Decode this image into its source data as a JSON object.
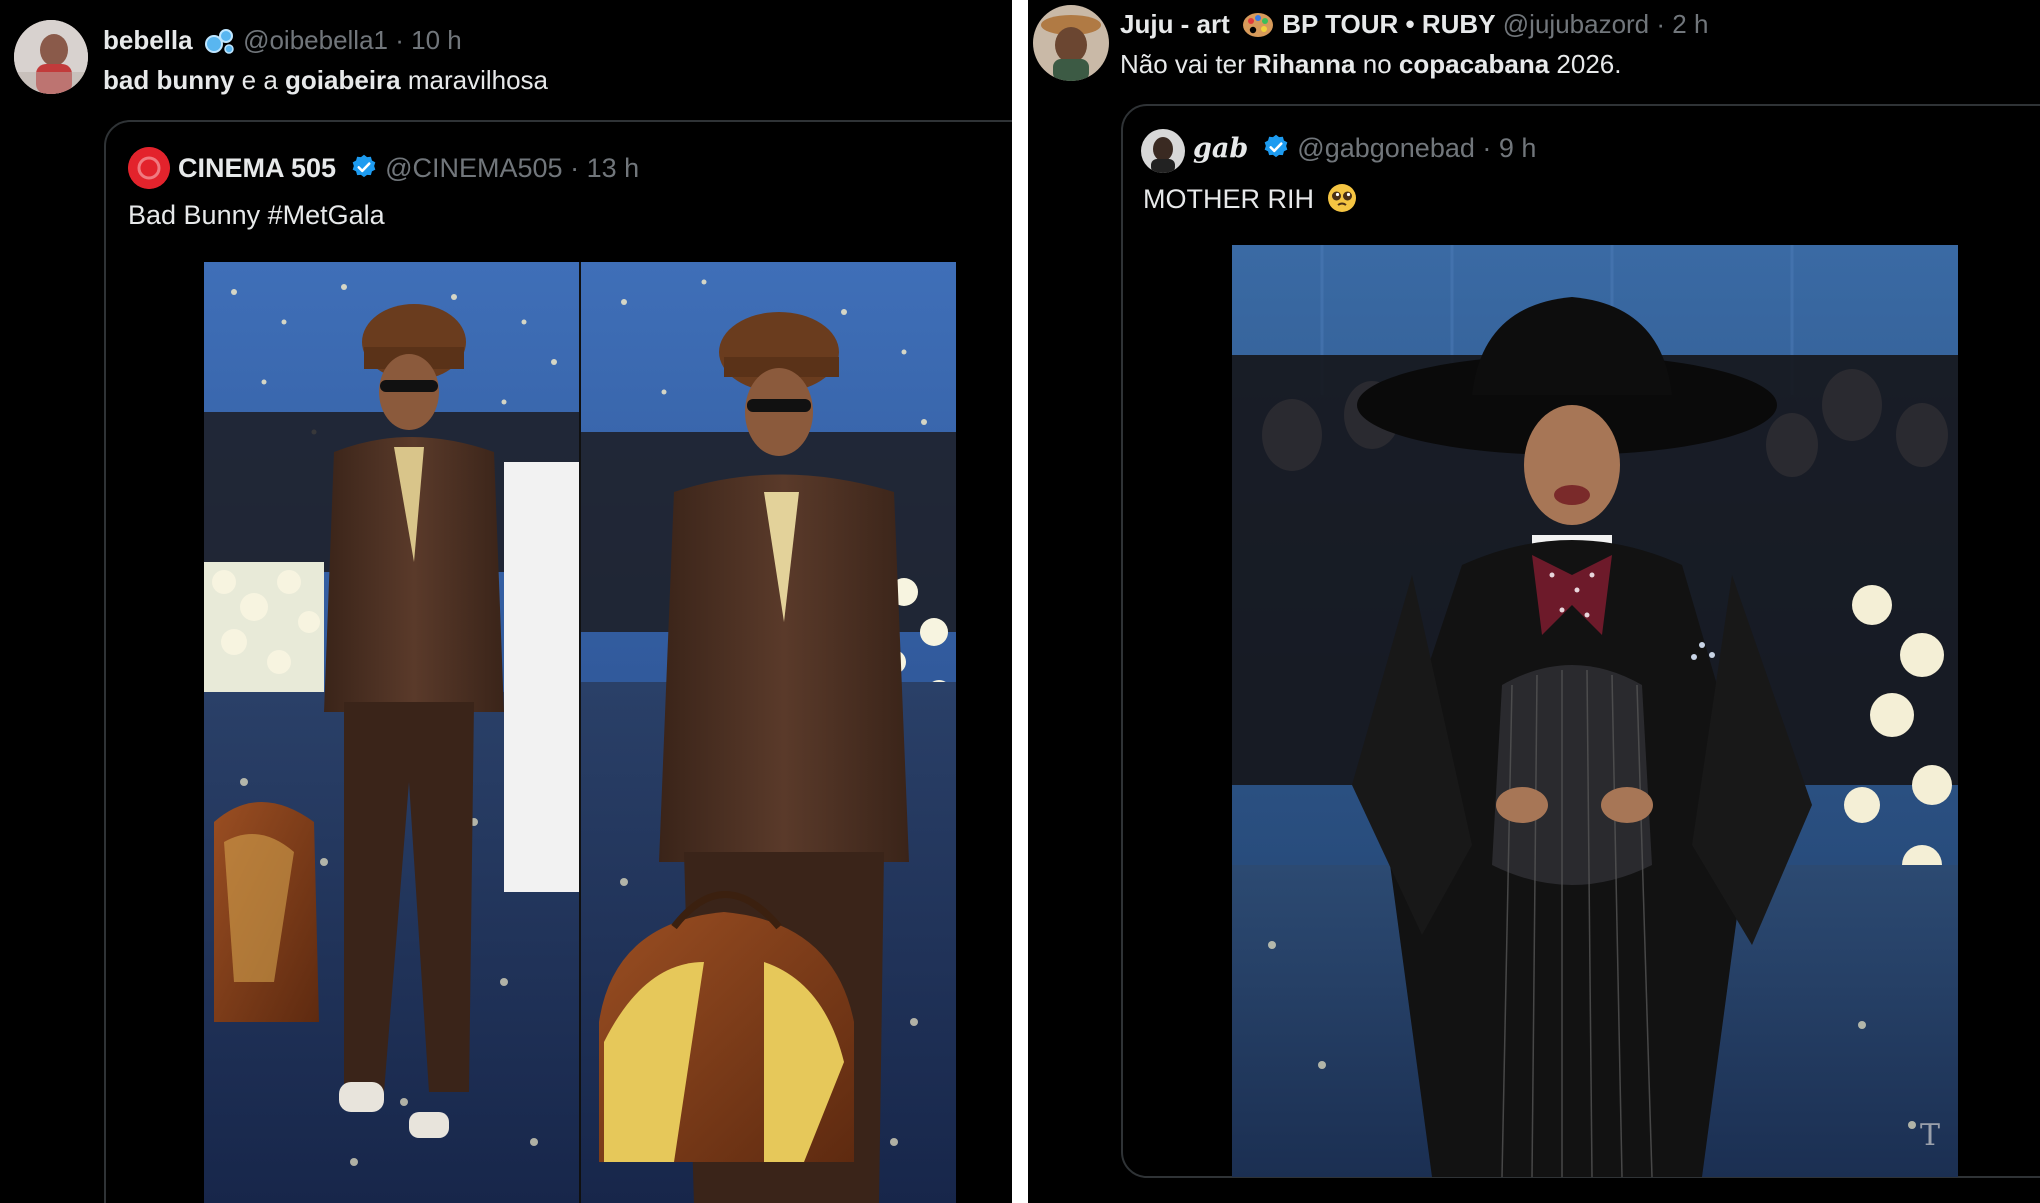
{
  "tweet_left": {
    "author_name": "bebella",
    "author_handle": "@oibebella1",
    "separator": "·",
    "time": "10 h",
    "text_parts": {
      "p1": "bad bunny",
      "p2": " e a ",
      "p3": "goiabeira",
      "p4": " maravilhosa"
    },
    "quoted": {
      "author_name": "CINEMA 505",
      "author_handle": "@CINEMA505",
      "separator": "·",
      "time": "13 h",
      "text": "Bad Bunny #MetGala",
      "media_icon": "photo-collage-bad-bunny-met-gala"
    }
  },
  "tweet_right": {
    "author_name": "Juju - art",
    "name_suffix": "BP TOUR • RUBY",
    "author_handle": "@jujubazord",
    "separator": "·",
    "time": "2 h",
    "text_parts": {
      "p1": "Não vai ter ",
      "p2": "Rihanna",
      "p3": " no ",
      "p4": "copacabana",
      "p5": " 2026."
    },
    "quoted": {
      "author_name": "gab",
      "author_handle": "@gabgonebad",
      "separator": "·",
      "time": "9 h",
      "text": "MOTHER RIH",
      "media_icon": "photo-rihanna-met-gala"
    }
  },
  "colors": {
    "background": "#000000",
    "text": "#e7e9ea",
    "muted": "#71767b",
    "verified": "#1d9bf0",
    "border": "#2f3336"
  }
}
